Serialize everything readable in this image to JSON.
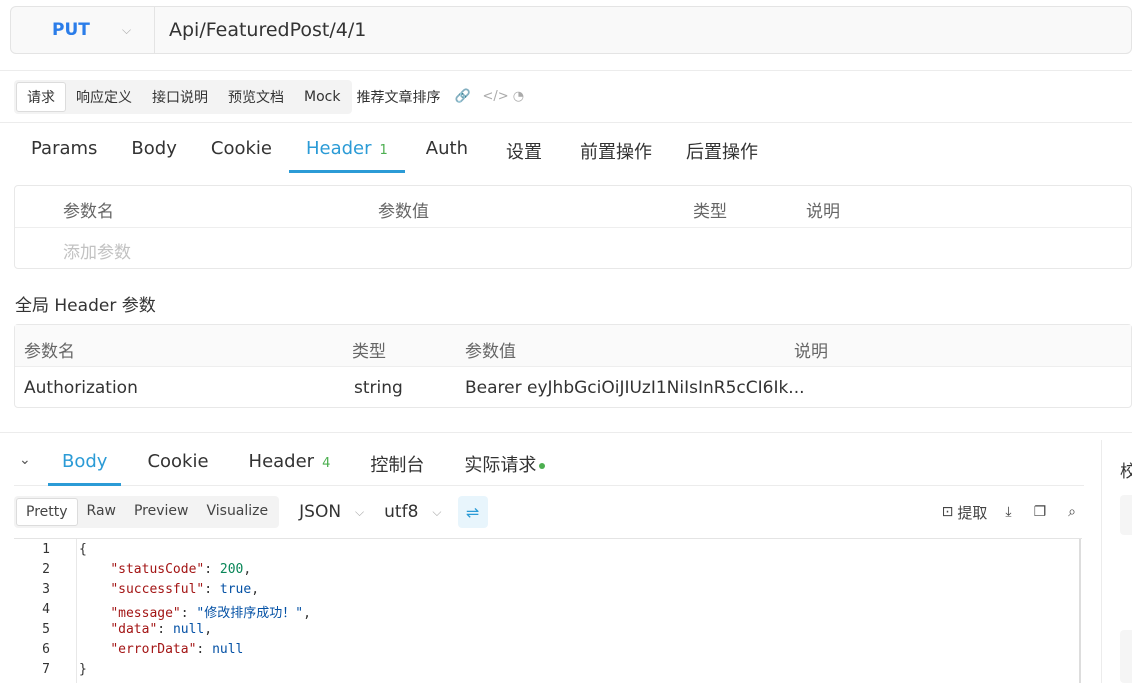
{
  "request": {
    "method": "PUT",
    "url": "Api/FeaturedPost/4/1"
  },
  "top_tabs": [
    {
      "label": "请求",
      "active": true
    },
    {
      "label": "响应定义"
    },
    {
      "label": "接口说明"
    },
    {
      "label": "预览文档"
    },
    {
      "label": "Mock"
    }
  ],
  "api_name": "推荐文章排序",
  "req_tabs": {
    "params": "Params",
    "body": "Body",
    "cookie": "Cookie",
    "header": "Header",
    "header_count": "1",
    "auth": "Auth",
    "settings": "设置",
    "pre": "前置操作",
    "post": "后置操作"
  },
  "params_table": {
    "col_name": "参数名",
    "col_value": "参数值",
    "col_type": "类型",
    "col_desc": "说明",
    "add_placeholder": "添加参数"
  },
  "global_header": {
    "title": "全局 Header 参数",
    "col_name": "参数名",
    "col_type": "类型",
    "col_value": "参数值",
    "col_desc": "说明",
    "row": {
      "name": "Authorization",
      "type": "string",
      "value": "Bearer eyJhbGciOiJIUzI1NiIsInR5cCI6Ik..."
    }
  },
  "resp_tabs": {
    "body": "Body",
    "cookie": "Cookie",
    "header": "Header",
    "header_count": "4",
    "console": "控制台",
    "actual": "实际请求"
  },
  "format": {
    "views": [
      "Pretty",
      "Raw",
      "Preview",
      "Visualize"
    ],
    "type": "JSON",
    "encoding": "utf8",
    "extract_label": "提取"
  },
  "side_char": "校",
  "code": {
    "line_numbers": [
      "1",
      "2",
      "3",
      "4",
      "5",
      "6",
      "7"
    ],
    "lines": {
      "l1": "{",
      "k2": "\"statusCode\"",
      "v2": "200",
      "k3": "\"successful\"",
      "v3": "true",
      "k4": "\"message\"",
      "v4": "\"修改排序成功！\"",
      "k5": "\"data\"",
      "v5": "null",
      "k6": "\"errorData\"",
      "v6": "null",
      "l7": "}"
    }
  }
}
